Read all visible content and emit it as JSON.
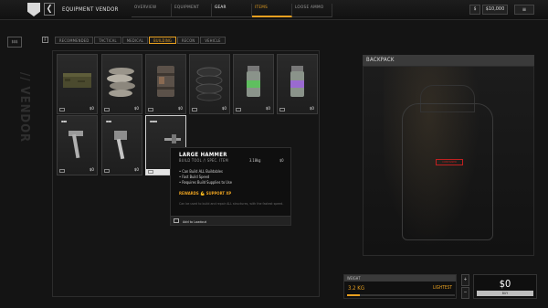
{
  "header": {
    "title": "EQUIPMENT VENDOR",
    "back_label": "❮",
    "tabs": [
      "OVERVIEW",
      "EQUIPMENT",
      "GEAR",
      "ITEMS",
      "LOOSE AMMO"
    ],
    "currency_symbol": "$",
    "money": "$10,000",
    "menu_label": "≡"
  },
  "side": {
    "badge": "$$$",
    "label": "// VENDOR"
  },
  "filter": {
    "toggle": "F",
    "categories": [
      "RECOMMENDED",
      "TACTICAL",
      "MEDICAL",
      "BUILDING",
      "RECON",
      "VEHICLE"
    ],
    "active": "BUILDING"
  },
  "grid": {
    "items": [
      {
        "price": "$0",
        "icon": "lumber-stack-icon"
      },
      {
        "price": "$0",
        "icon": "sandbags-icon"
      },
      {
        "price": "$0",
        "icon": "barrel-icon"
      },
      {
        "price": "$0",
        "icon": "tires-icon"
      },
      {
        "price": "$0",
        "icon": "green-canister-icon"
      },
      {
        "price": "$0",
        "icon": "purple-canister-icon"
      },
      {
        "price": "$0",
        "dots": "▪▪▪",
        "icon": "claw-hammer-icon"
      },
      {
        "price": "$0",
        "dots": "▪▪▪",
        "icon": "sledgehammer-icon"
      },
      {
        "price": "",
        "dots": "▪▪▪▪",
        "icon": "large-hammer-icon"
      }
    ]
  },
  "tooltip": {
    "name": "LARGE HAMMER",
    "subtitle": "BUILD TOOL // SPEC. ITEM",
    "weight": "3.18kg",
    "price": "$0",
    "bullets": [
      "• Can Build ALL Buildables",
      "• Fast Build Speed",
      "• Requires Build Supplies to Use"
    ],
    "rewards": "REWARDS 💪 SUPPORT XP",
    "description": "Can be used to build and repair ALL structures, with the fastest speed.",
    "add_label": "Add to Loadout"
  },
  "backpack": {
    "title": "BACKPACK",
    "red_tag": "CONTAINER"
  },
  "weight": {
    "label": "WEIGHT",
    "value": "3.2 KG",
    "status": "LIGHTEST",
    "fill": 0.12
  },
  "total": {
    "value": "$0",
    "button": "BUY"
  },
  "colors": {
    "accent": "#e8a020",
    "background": "#141414",
    "warning": "#c02020"
  }
}
